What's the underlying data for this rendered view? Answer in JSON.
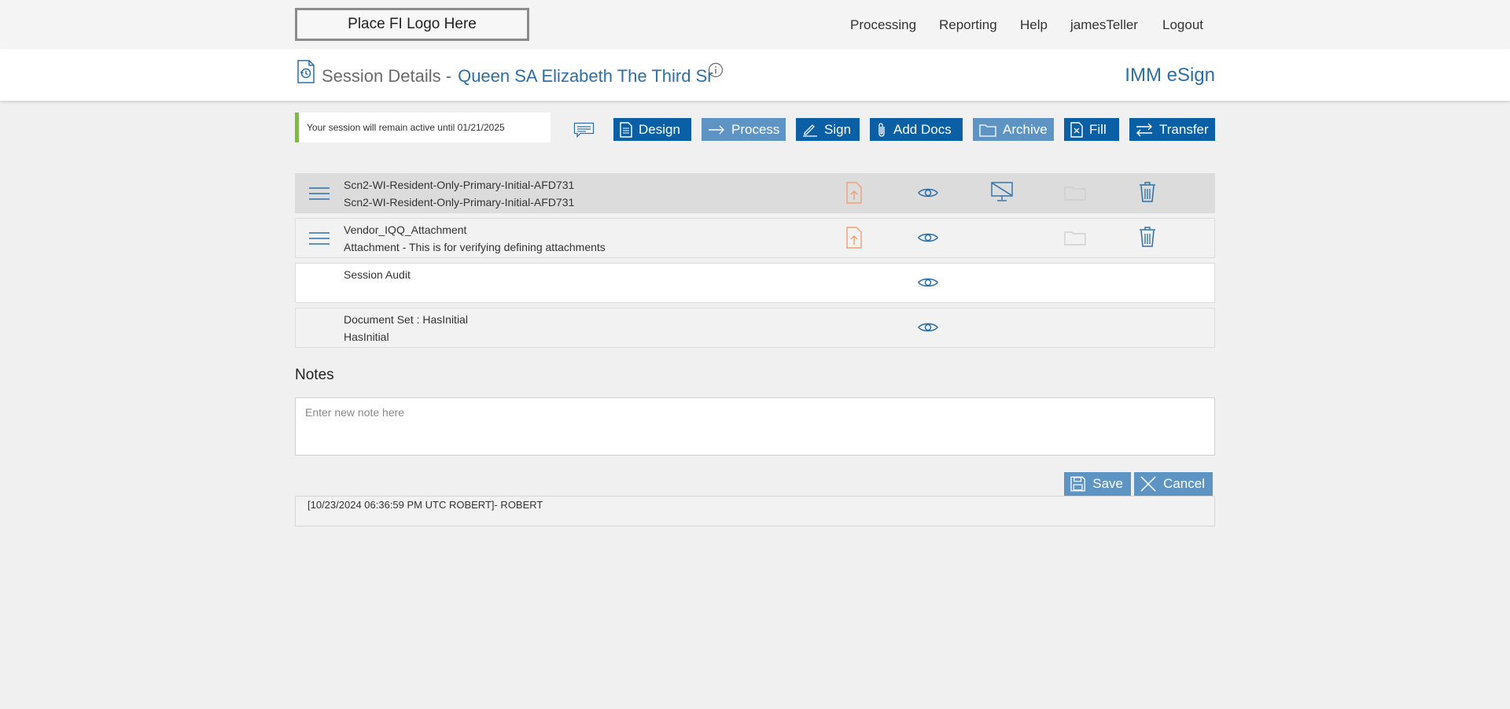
{
  "logo": {
    "text": "Place FI Logo Here"
  },
  "nav": {
    "items": [
      {
        "label": "Processing"
      },
      {
        "label": "Reporting"
      },
      {
        "label": "Help"
      },
      {
        "label": "jamesTeller"
      },
      {
        "label": "Logout"
      }
    ]
  },
  "header": {
    "title_prefix": "Session Details -",
    "session_name": "Queen SA Elizabeth The Third Sr",
    "brand": "IMM eSign"
  },
  "session_notice": "Your session will remain active until 01/21/2025",
  "toolbar": {
    "design": "Design",
    "process": "Process",
    "sign": "Sign",
    "add_docs": "Add Docs",
    "archive": "Archive",
    "fill": "Fill",
    "transfer": "Transfer"
  },
  "documents": [
    {
      "line1": "Scn2-WI-Resident-Only-Primary-Initial-AFD731",
      "line2": "Scn2-WI-Resident-Only-Primary-Initial-AFD731"
    },
    {
      "line1": "Vendor_IQQ_Attachment",
      "line2": "Attachment - This is for verifying defining attachments"
    },
    {
      "line1": "Session Audit",
      "line2": ""
    },
    {
      "line1": "Document Set : HasInitial",
      "line2": "HasInitial"
    }
  ],
  "notes": {
    "title": "Notes",
    "placeholder": "Enter new note here",
    "save": "Save",
    "cancel": "Cancel",
    "entries": [
      {
        "text": "[10/23/2024 06:36:59 PM UTC ROBERT]- ROBERT"
      }
    ]
  },
  "colors": {
    "primary": "#0b5fa5",
    "primary_light": "#5d94c4",
    "link": "#2c6fa8",
    "upload_orange": "#f0a070",
    "active_green": "#7cbd3c"
  }
}
